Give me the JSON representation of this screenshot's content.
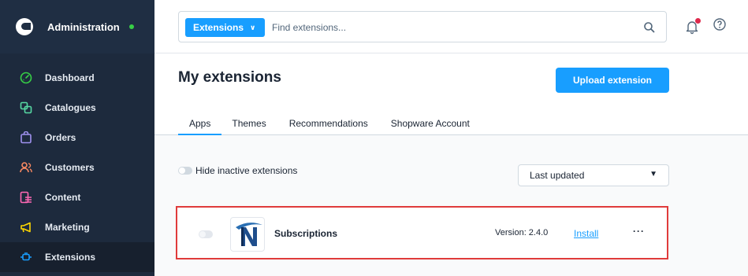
{
  "sidebar": {
    "title": "Administration",
    "status_color": "#37d046",
    "items": [
      {
        "label": "Dashboard",
        "icon": "dashboard-icon",
        "color": "#37d046"
      },
      {
        "label": "Catalogues",
        "icon": "products-icon",
        "color": "#57d9a3"
      },
      {
        "label": "Orders",
        "icon": "shopping-bag-icon",
        "color": "#a092f0"
      },
      {
        "label": "Customers",
        "icon": "customers-icon",
        "color": "#f88962"
      },
      {
        "label": "Content",
        "icon": "content-icon",
        "color": "#ff68b4"
      },
      {
        "label": "Marketing",
        "icon": "megaphone-icon",
        "color": "#ffd700"
      },
      {
        "label": "Extensions",
        "icon": "plug-icon",
        "color": "#189eff"
      }
    ]
  },
  "search": {
    "type_label": "Extensions",
    "placeholder": "Find extensions..."
  },
  "page": {
    "title": "My extensions",
    "upload_label": "Upload extension"
  },
  "tabs": [
    {
      "label": "Apps",
      "active": true
    },
    {
      "label": "Themes"
    },
    {
      "label": "Recommendations"
    },
    {
      "label": "Shopware Account"
    }
  ],
  "filter": {
    "hide_inactive_label": "Hide inactive extensions",
    "sort_value": "Last updated"
  },
  "extension": {
    "name": "Subscriptions",
    "version": "Version: 2.4.0",
    "install_label": "Install",
    "more_label": "···"
  },
  "colors": {
    "accent": "#189eff",
    "highlight": "#e03b3b",
    "sidebar_bg": "#1d2a3d"
  }
}
